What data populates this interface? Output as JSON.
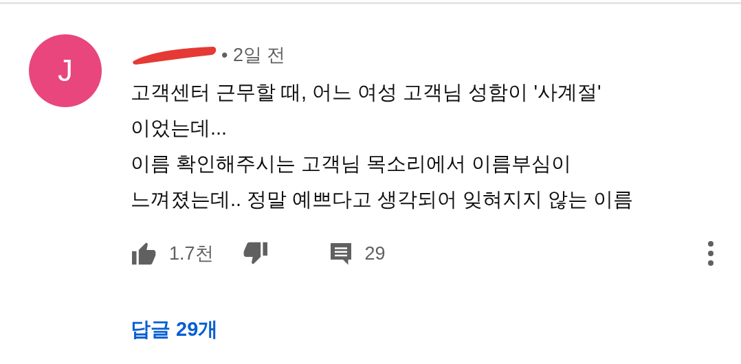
{
  "comment": {
    "avatar_letter": "J",
    "author_redacted": true,
    "time": "• 2일 전",
    "lines": [
      "고객센터 근무할 때, 어느 여성 고객님 성함이 '사계절'",
      "이었는데...",
      "이름 확인해주시는 고객님 목소리에서 이름부심이",
      "느껴졌는데.. 정말 예쁘다고 생각되어 잊혀지지 않는 이름"
    ],
    "likes": "1.7천",
    "reply_count": "29",
    "replies_link": "답글 29개"
  }
}
